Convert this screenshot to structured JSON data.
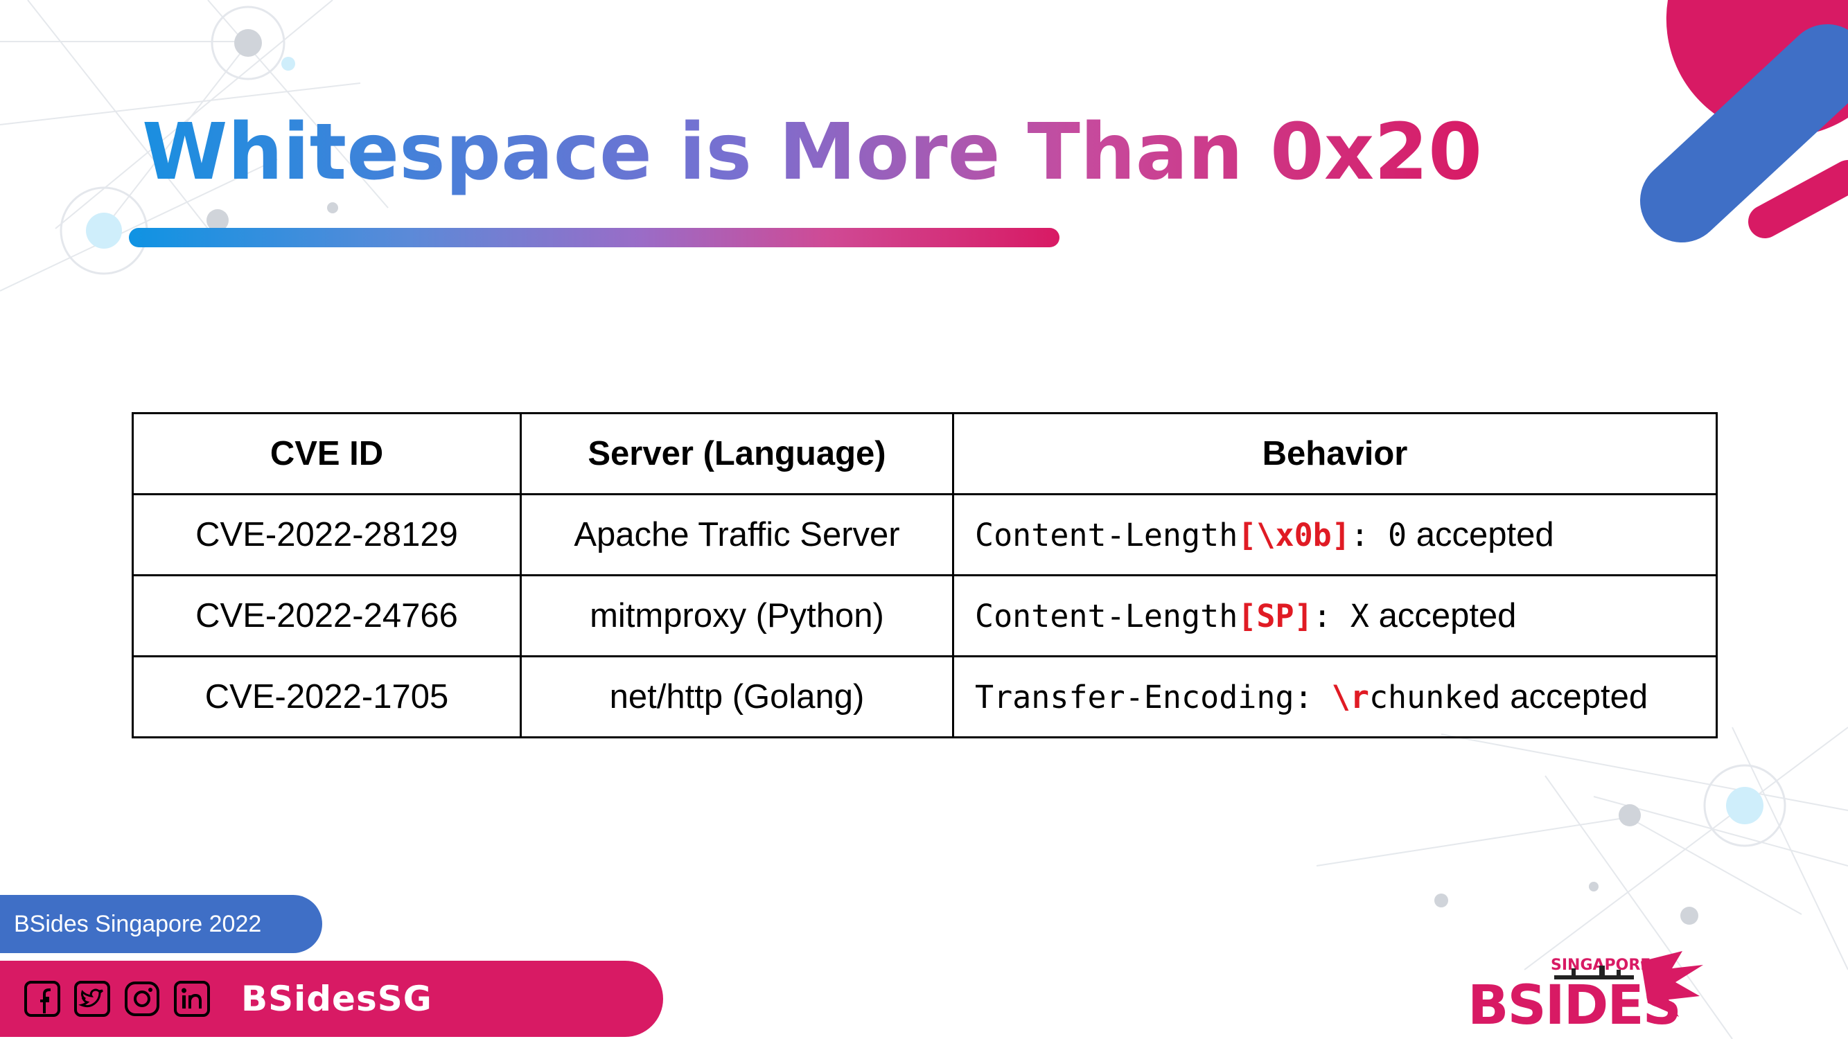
{
  "slide": {
    "title": "Whitespace is More Than 0x20"
  },
  "table": {
    "headers": [
      "CVE ID",
      "Server (Language)",
      "Behavior"
    ],
    "rows": [
      {
        "cve": "CVE-2022-28129",
        "server": "Apache Traffic Server",
        "behavior": {
          "code_pre": "Content-Length",
          "code_hl": "[\\x0b]",
          "code_post": ": 0",
          "text_after": " accepted"
        }
      },
      {
        "cve": "CVE-2022-24766",
        "server": "mitmproxy (Python)",
        "behavior": {
          "code_pre": "Content-Length",
          "code_hl": "[SP]",
          "code_post": ": X",
          "text_after": " accepted"
        }
      },
      {
        "cve": "CVE-2022-1705",
        "server": "net/http (Golang)",
        "behavior": {
          "code_pre": "Transfer-Encoding: ",
          "code_hl": "\\r",
          "code_post": "chunked",
          "text_after": " accepted"
        }
      }
    ]
  },
  "footer": {
    "event_label": "BSides Singapore 2022",
    "social_handle": "BSidesSG",
    "social_icons": [
      "facebook-icon",
      "twitter-icon",
      "instagram-icon",
      "linkedin-icon"
    ],
    "logo_top_text": "SINGAPORE",
    "logo_main_text": "BSIDES"
  },
  "colors": {
    "accent_magenta": "#d81a64",
    "accent_blue": "#3f6fc6",
    "title_gradient_start": "#1a8fe0",
    "highlight_red": "#e01b24"
  }
}
